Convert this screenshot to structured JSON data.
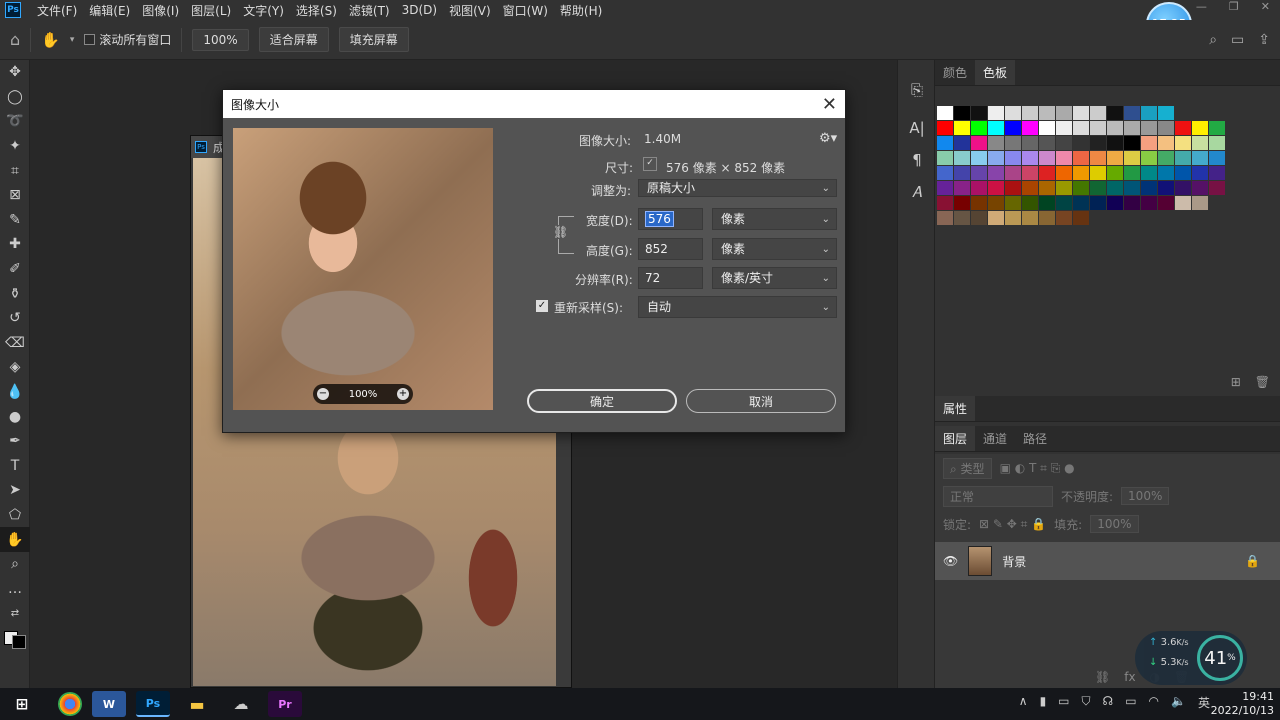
{
  "menu": {
    "items": [
      "文件(F)",
      "编辑(E)",
      "图像(I)",
      "图层(L)",
      "文字(Y)",
      "选择(S)",
      "滤镜(T)",
      "3D(D)",
      "视图(V)",
      "窗口(W)",
      "帮助(H)"
    ]
  },
  "clock_bubble": "17:25",
  "options": {
    "scroll_all": "滚动所有窗口",
    "zoom": "100%",
    "fit_screen": "适合屏幕",
    "fill_screen": "填充屏幕"
  },
  "document": {
    "tab_title": "成"
  },
  "panels": {
    "color_tab": "颜色",
    "swatches_tab": "色板",
    "properties_tab": "属性",
    "layers_tab": "图层",
    "channels_tab": "通道",
    "paths_tab": "路径",
    "kind_placeholder": "类型",
    "blend_mode": "正常",
    "opacity_label": "不透明度:",
    "opacity_value": "100%",
    "lock_label": "锁定:",
    "fill_label": "填充:",
    "fill_value": "100%",
    "layer_name": "背景"
  },
  "dialog": {
    "title": "图像大小",
    "image_size_label": "图像大小:",
    "image_size_value": "1.40M",
    "dimensions_label": "尺寸:",
    "dimensions_value": "576 像素 × 852 像素",
    "fit_to_label": "调整为:",
    "fit_to_value": "原稿大小",
    "width_label": "宽度(D):",
    "width_value": "576",
    "width_unit": "像素",
    "height_label": "高度(G):",
    "height_value": "852",
    "height_unit": "像素",
    "resolution_label": "分辨率(R):",
    "resolution_value": "72",
    "resolution_unit": "像素/英寸",
    "resample_label": "重新采样(S):",
    "resample_value": "自动",
    "preview_zoom": "100%",
    "ok": "确定",
    "cancel": "取消"
  },
  "netmon": {
    "up": "3.6",
    "up_unit": "K/s",
    "down": "5.3",
    "down_unit": "K/s",
    "pct": "41",
    "pct_sign": "%"
  },
  "taskbar": {
    "ime": "英",
    "time": "19:41",
    "date": "2022/10/13"
  },
  "colors": {
    "accent_ps": "#31a8ff",
    "dialog_bg": "#535353",
    "selection": "#2a68c8"
  }
}
